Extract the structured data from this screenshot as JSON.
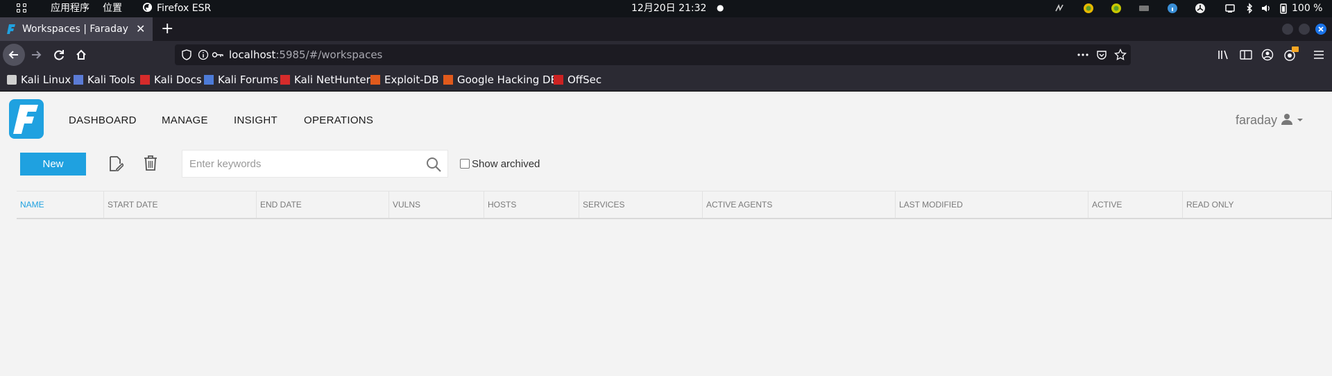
{
  "os_bar": {
    "apps_label": "应用程序",
    "places_label": "位置",
    "active_app": "Firefox ESR",
    "clock": "12月20日 21:32",
    "battery": "100 %"
  },
  "browser": {
    "tab_title": "Workspaces | Faraday",
    "tab_close": "✕",
    "new_tab": "+",
    "url_host": "localhost",
    "url_rest": ":5985/#/workspaces"
  },
  "bookmarks": [
    {
      "label": "Kali Linux",
      "color": "#d0d0d0"
    },
    {
      "label": "Kali Tools",
      "color": "#5b7bd5"
    },
    {
      "label": "Kali Docs",
      "color": "#d62b2b"
    },
    {
      "label": "Kali Forums",
      "color": "#4d7bd8"
    },
    {
      "label": "Kali NetHunter",
      "color": "#d62b2b"
    },
    {
      "label": "Exploit-DB",
      "color": "#e05a1c"
    },
    {
      "label": "Google Hacking DB",
      "color": "#e05a1c"
    },
    {
      "label": "OffSec",
      "color": "#c22"
    }
  ],
  "app": {
    "nav": [
      "DASHBOARD",
      "MANAGE",
      "INSIGHT",
      "OPERATIONS"
    ],
    "user": "faraday",
    "new_button": "New",
    "search_placeholder": "Enter keywords",
    "show_archived": "Show archived",
    "columns": [
      "NAME",
      "START DATE",
      "END DATE",
      "VULNS",
      "HOSTS",
      "SERVICES",
      "ACTIVE AGENTS",
      "LAST MODIFIED",
      "ACTIVE",
      "READ ONLY"
    ],
    "accent_color": "#1fa1e0"
  }
}
